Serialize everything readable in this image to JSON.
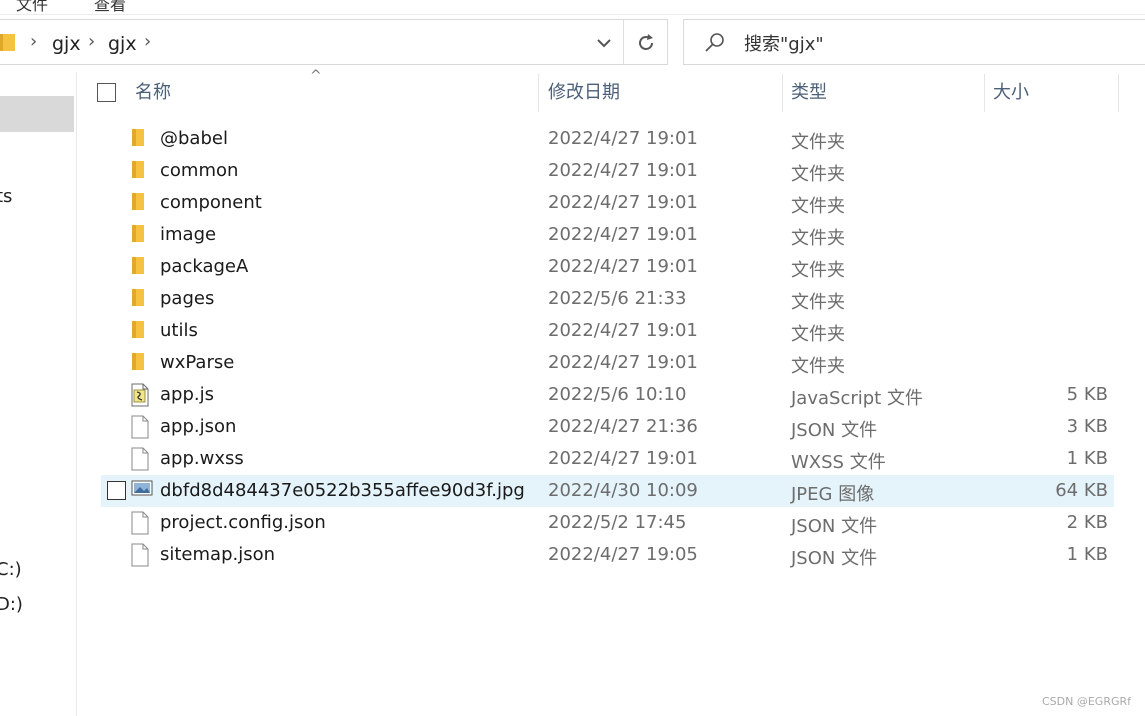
{
  "ribbon": {
    "partial_labels": [
      "文件",
      "查看"
    ]
  },
  "address_bar": {
    "breadcrumbs": [
      {
        "label": "gjx"
      },
      {
        "label": "gjx"
      }
    ],
    "folder_icon": "folder-icon",
    "dropdown_icon": "chevron-down-icon",
    "refresh_icon": "refresh-icon"
  },
  "search": {
    "placeholder": "搜索\"gjx\"",
    "icon": "search-icon"
  },
  "nav_pane": {
    "partial_items": [
      {
        "label": "ts"
      },
      {
        "label": "C:)"
      },
      {
        "label": "D:)"
      }
    ]
  },
  "columns": {
    "name": "名称",
    "date": "修改日期",
    "type": "类型",
    "size": "大小"
  },
  "files": [
    {
      "name": "@babel",
      "date": "2022/4/27 19:01",
      "type": "文件夹",
      "size": "",
      "icon": "folder-icon"
    },
    {
      "name": "common",
      "date": "2022/4/27 19:01",
      "type": "文件夹",
      "size": "",
      "icon": "folder-icon"
    },
    {
      "name": "component",
      "date": "2022/4/27 19:01",
      "type": "文件夹",
      "size": "",
      "icon": "folder-icon"
    },
    {
      "name": "image",
      "date": "2022/4/27 19:01",
      "type": "文件夹",
      "size": "",
      "icon": "folder-icon"
    },
    {
      "name": "packageA",
      "date": "2022/4/27 19:01",
      "type": "文件夹",
      "size": "",
      "icon": "folder-icon"
    },
    {
      "name": "pages",
      "date": "2022/5/6 21:33",
      "type": "文件夹",
      "size": "",
      "icon": "folder-icon"
    },
    {
      "name": "utils",
      "date": "2022/4/27 19:01",
      "type": "文件夹",
      "size": "",
      "icon": "folder-icon"
    },
    {
      "name": "wxParse",
      "date": "2022/4/27 19:01",
      "type": "文件夹",
      "size": "",
      "icon": "folder-icon"
    },
    {
      "name": "app.js",
      "date": "2022/5/6 10:10",
      "type": "JavaScript 文件",
      "size": "5 KB",
      "icon": "javascript-file-icon"
    },
    {
      "name": "app.json",
      "date": "2022/4/27 21:36",
      "type": "JSON 文件",
      "size": "3 KB",
      "icon": "file-icon"
    },
    {
      "name": "app.wxss",
      "date": "2022/4/27 19:01",
      "type": "WXSS 文件",
      "size": "1 KB",
      "icon": "file-icon"
    },
    {
      "name": "dbfd8d484437e0522b355affee90d3f.jpg",
      "date": "2022/4/30 10:09",
      "type": "JPEG 图像",
      "size": "64 KB",
      "icon": "image-file-icon",
      "selected": true
    },
    {
      "name": "project.config.json",
      "date": "2022/5/2 17:45",
      "type": "JSON 文件",
      "size": "2 KB",
      "icon": "file-icon"
    },
    {
      "name": "sitemap.json",
      "date": "2022/4/27 19:05",
      "type": "JSON 文件",
      "size": "1 KB",
      "icon": "file-icon"
    }
  ],
  "watermark": "CSDN @EGRGRf"
}
